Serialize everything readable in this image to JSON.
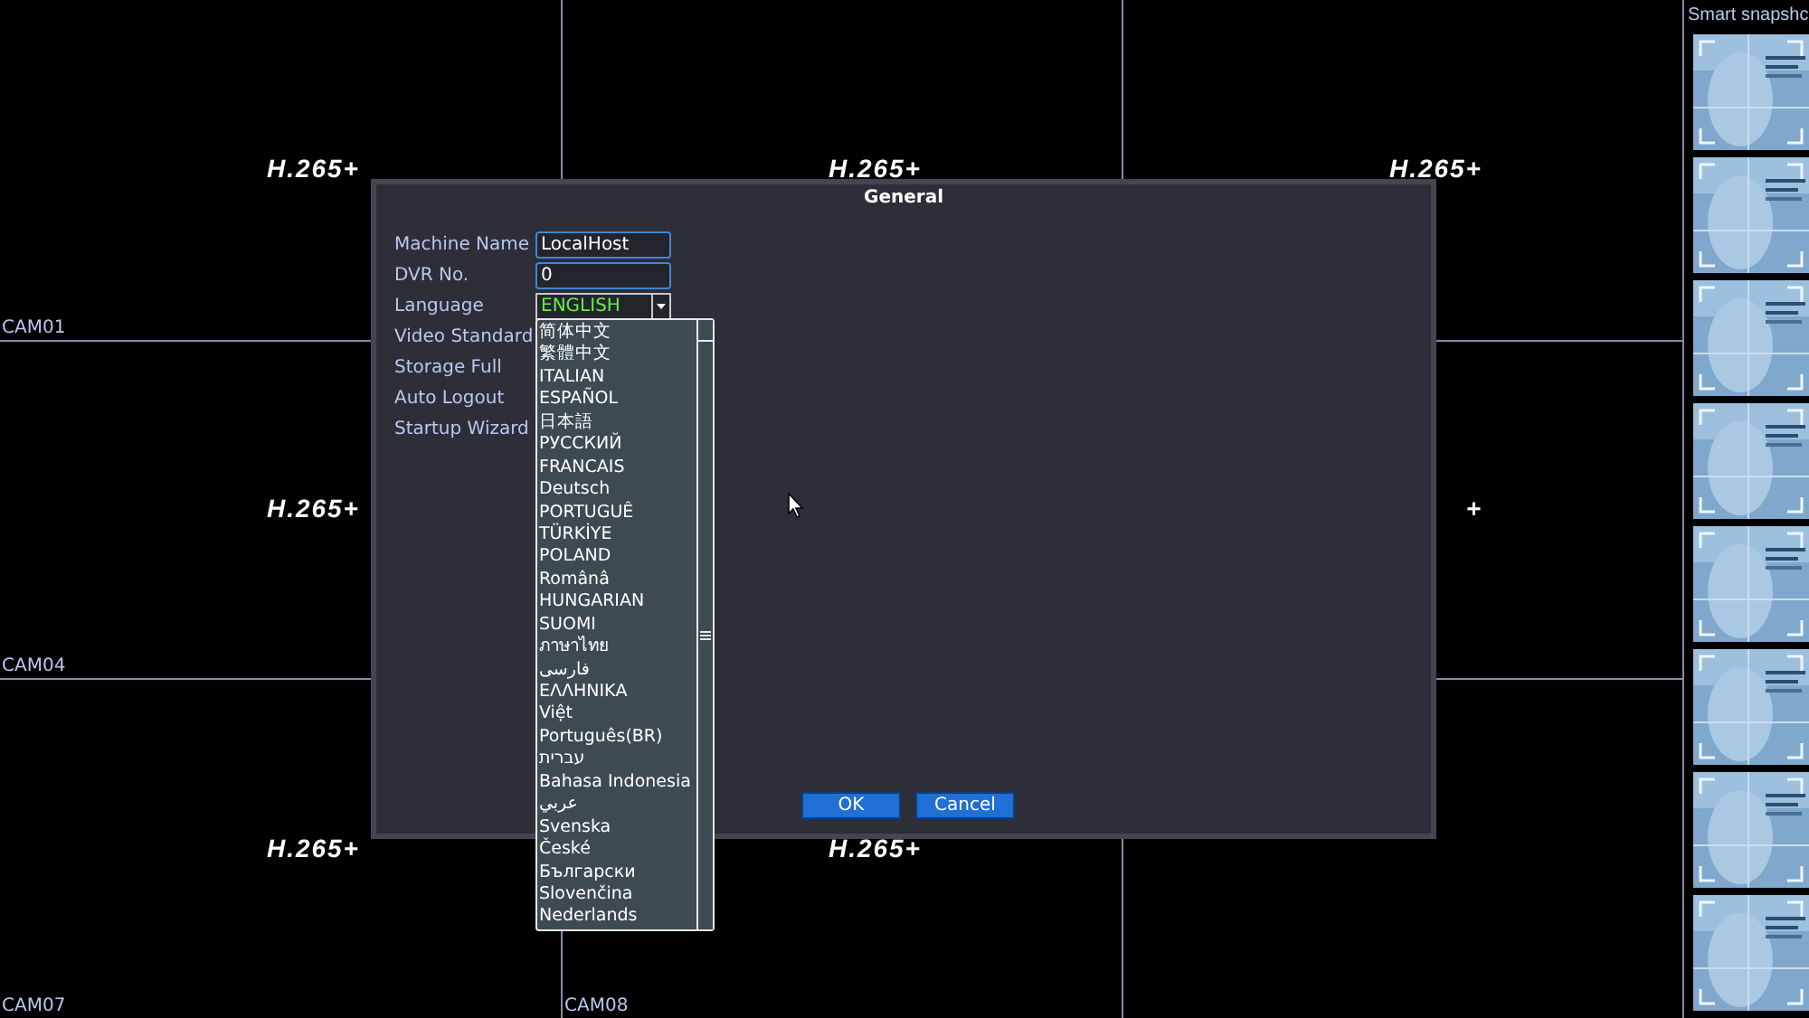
{
  "camera_rows": [
    [
      {
        "kind": "feed",
        "label": "CAM01",
        "codec": "H.265+"
      },
      {
        "kind": "feed",
        "codec": "H.265+"
      },
      {
        "kind": "feed",
        "codec": "H.265+"
      }
    ],
    [
      {
        "kind": "feed",
        "label": "CAM04",
        "codec": "H.265+"
      },
      {
        "kind": "feed",
        "codec": "+"
      }
    ],
    [
      {
        "kind": "feed",
        "label": "CAM07",
        "codec": "H.265+"
      },
      {
        "kind": "feed",
        "label": "CAM08",
        "codec": "H.265+"
      },
      {
        "kind": "empty"
      }
    ]
  ],
  "dialog": {
    "title": "General",
    "fields": [
      {
        "label": "Machine Name",
        "kind": "text",
        "value": "LocalHost"
      },
      {
        "label": "DVR No.",
        "kind": "text",
        "value": "0"
      },
      {
        "label": "Language",
        "kind": "select",
        "value": "ENGLISH",
        "expanded": true
      },
      {
        "label": "Video Standard",
        "kind": "hidden"
      },
      {
        "label": "Storage Full",
        "kind": "hidden"
      },
      {
        "label": "Auto Logout",
        "kind": "hidden"
      },
      {
        "label": "Startup Wizard",
        "kind": "hidden"
      }
    ],
    "language_options": [
      "简体中文",
      "繁體中文",
      "ITALIAN",
      "ESPAÑOL",
      "日本語",
      "РУССКИЙ",
      "FRANCAIS",
      "Deutsch",
      "PORTUGUÊ",
      "TÜRKİYE",
      "POLAND",
      "Românâ",
      "HUNGARIAN",
      "SUOMI",
      "ภาษาไทย",
      "فارسی",
      "ΕΛΛΗΝΙΚΑ",
      "Việt",
      "Português(BR)",
      "עברית",
      "Bahasa Indonesia",
      "عربي",
      "Svenska",
      "České",
      "Български",
      "Slovenčina",
      "Nederlands"
    ],
    "buttons": [
      "OK",
      "Cancel"
    ]
  },
  "snapshot_panel": {
    "title": "Smart snapshc"
  }
}
